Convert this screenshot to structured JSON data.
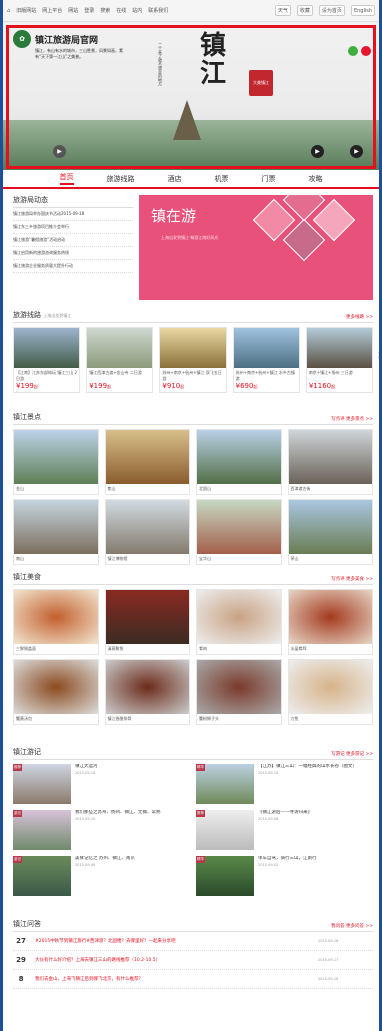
{
  "topbar": {
    "items": [
      "旧版网站",
      "网上平台",
      "网站",
      "登录",
      "搜索",
      "在线",
      "站内",
      "联系我们"
    ],
    "right": [
      "天气",
      "收藏",
      "设为首页",
      "English"
    ]
  },
  "banner": {
    "site_name": "镇江旅游局官网",
    "subtitle": "镇江，有山有水的城市，三山胜景，风景如画，素有“天下第一江山”之美誉。",
    "calligraphy": "镇江",
    "poem": "一个来了就不想走的地方",
    "stamp": "大美镇江"
  },
  "nav": {
    "items": [
      "首页",
      "旅游线路",
      "酒店",
      "机票",
      "门票",
      "攻略"
    ],
    "active": 0
  },
  "news": {
    "title": "旅游局动态",
    "more": "",
    "items": [
      "镇江旅游局举办国庆节活动2015-09-18",
      "镇江东三乡旅游项目推介会举行",
      "镇江旅游“暑假旅游”活动启动",
      "镇江启用新的旅游咨询服务热线",
      "镇江旅游企业服务质量大提升行动"
    ]
  },
  "promo": {
    "title": "镇在游",
    "subtitle": "上海出发到镇江\n畅游江南好风光"
  },
  "routes": {
    "title": "旅游线路",
    "subtitle": "上海出发到镇江",
    "more": "更多线路 >>",
    "items": [
      {
        "cap": "【江南】江苏东部纯玩 镇江三山 2日游",
        "price": "199",
        "unit": "起"
      },
      {
        "cap": "镇江西津古渡+金山寺 二日游",
        "price": "199",
        "unit": "起"
      },
      {
        "cap": "苏州+南京+杭州+镇江 双飞五日游",
        "price": "910",
        "unit": "起"
      },
      {
        "cap": "苏州+南京+杭州+镇江 水乡古镇游",
        "price": "690",
        "unit": "起"
      },
      {
        "cap": "南京+镇江+扬州 三日游",
        "price": "1160",
        "unit": "起"
      }
    ]
  },
  "scenery": {
    "title": "镇江景点",
    "links": [
      "写点评",
      "更多景点 >>"
    ],
    "items": [
      "金山",
      "焦山",
      "北固山",
      "西津渡古街",
      "南山",
      "镇江博物馆",
      "宝华山",
      "茅山"
    ]
  },
  "food": {
    "title": "镇江美食",
    "links": [
      "写点评",
      "更多美食 >>"
    ],
    "items": [
      "三鲜锅盖面",
      "清蒸鲥鱼",
      "肴肉",
      "水晶肴蹄",
      "蟹黄汤包",
      "镇江香醋排骨",
      "蟹粉狮子头",
      "刀鱼"
    ]
  },
  "travels": {
    "title": "镇江游记",
    "links": [
      "写游记",
      "更多游记 >>"
    ],
    "items": [
      {
        "tag": "推荐",
        "title": "镇江大运河",
        "by": "2015-09-16"
      },
      {
        "tag": "精华",
        "title": "【江苏】镇江三山：一幅经典的山水长卷（图文）",
        "by": "2015-09-15"
      },
      {
        "tag": "游记",
        "title": "我们那些之苏州、扬州、镇江、无锡、常熟",
        "by": "2015-09-10"
      },
      {
        "tag": "推荐",
        "title": "《镇江游后——寻访归来》",
        "by": "2015-09-08"
      },
      {
        "tag": "游记",
        "title": "美食记忆之 苏州、镇江、南京",
        "by": "2015-09-06"
      },
      {
        "tag": "精华",
        "title": "单车自驾，骑行三山，江南行",
        "by": "2015-09-02"
      }
    ]
  },
  "qa": {
    "title": "镇江问答",
    "links": [
      "我问答",
      "更多问答 >>"
    ],
    "items": [
      {
        "n": "27",
        "q": "#2015中秋节到镇江旅行#西津渡？北固楼？去哪里好？一起来分享吧",
        "d": "2015-09-18"
      },
      {
        "n": "29",
        "q": "大伙有什么好介绍？上海去镇江三山的路线推荐（10.2-10.5）",
        "d": "2015-09-17"
      },
      {
        "n": "8",
        "q": "我们去金山、上海飞镇江后到哪飞北京，有什么推荐？",
        "d": "2015-09-16"
      }
    ]
  }
}
